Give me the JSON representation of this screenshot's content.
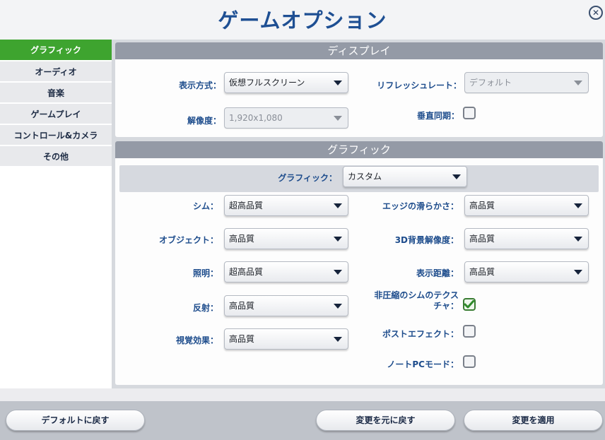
{
  "window": {
    "title": "ゲームオプション",
    "close_glyph": "✕"
  },
  "sidebar": {
    "items": [
      {
        "label": "グラフィック",
        "active": true
      },
      {
        "label": "オーディオ"
      },
      {
        "label": "音楽"
      },
      {
        "label": "ゲームプレイ"
      },
      {
        "label": "コントロール&カメラ"
      },
      {
        "label": "その他"
      }
    ]
  },
  "display": {
    "header": "ディスプレイ",
    "mode_label": "表示方式：",
    "mode_value": "仮想フルスクリーン",
    "refresh_label": "リフレッシュレート：",
    "refresh_value": "デフォルト",
    "resolution_label": "解像度：",
    "resolution_value": "1,920x1,080",
    "vsync_label": "垂直同期：",
    "vsync_checked": false
  },
  "graphics": {
    "header": "グラフィック",
    "preset_label": "グラフィック：",
    "preset_value": "カスタム",
    "sims_label": "シム：",
    "sims_value": "超高品質",
    "objects_label": "オブジェクト：",
    "objects_value": "高品質",
    "lighting_label": "照明：",
    "lighting_value": "超高品質",
    "reflections_label": "反射：",
    "reflections_value": "高品質",
    "effects_label": "視覚効果：",
    "effects_value": "高品質",
    "edge_label": "エッジの滑らかさ：",
    "edge_value": "高品質",
    "bg3d_label": "3D背景解像度：",
    "bg3d_value": "高品質",
    "distance_label": "表示距離：",
    "distance_value": "高品質",
    "uncompressed_label_line1": "非圧縮のシムのテクス",
    "uncompressed_label_line2": "チャ：",
    "uncompressed_checked": true,
    "posteffect_label": "ポストエフェクト：",
    "posteffect_checked": false,
    "laptop_label": "ノートPCモード：",
    "laptop_checked": false
  },
  "footer": {
    "default_button": "デフォルトに戻す",
    "revert_button": "変更を元に戻す",
    "apply_button": "変更を適用"
  },
  "colors": {
    "accent_green": "#3ea42f",
    "title_blue": "#1e4f93",
    "label_blue": "#1d4c8c"
  }
}
